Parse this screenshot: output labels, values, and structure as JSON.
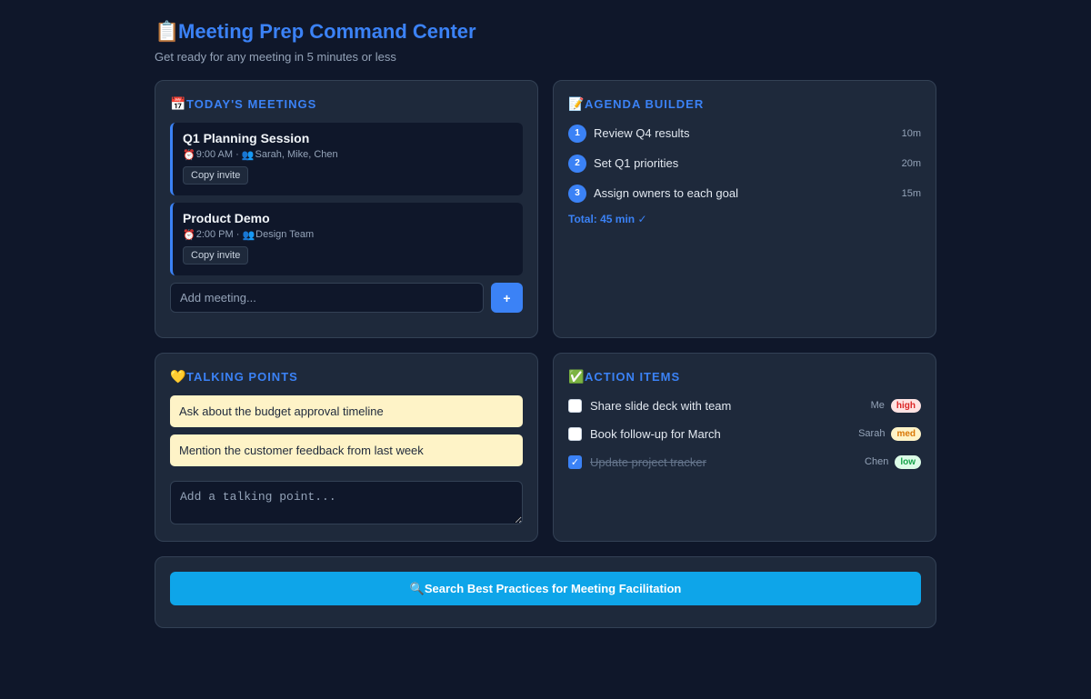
{
  "header": {
    "emoji": "📋",
    "title": "Meeting Prep Command Center",
    "subtitle": "Get ready for any meeting in 5 minutes or less"
  },
  "meetings_card": {
    "emoji": "📅",
    "heading": "TODAY'S MEETINGS",
    "meetings": [
      {
        "title": "Q1 Planning Session",
        "time_icon": "⏰",
        "time": "9:00 AM",
        "sep": " · ",
        "people_icon": "👥",
        "attendees": "Sarah, Mike, Chen",
        "copy_label": "Copy invite"
      },
      {
        "title": "Product Demo",
        "time_icon": "⏰",
        "time": "2:00 PM",
        "sep": " · ",
        "people_icon": "👥",
        "attendees": "Design Team",
        "copy_label": "Copy invite"
      }
    ],
    "add_placeholder": "Add meeting...",
    "add_button": "+"
  },
  "agenda_card": {
    "emoji": "📝",
    "heading": "AGENDA BUILDER",
    "items": [
      {
        "num": "1",
        "text": "Review Q4 results",
        "duration": "10m"
      },
      {
        "num": "2",
        "text": "Set Q1 priorities",
        "duration": "20m"
      },
      {
        "num": "3",
        "text": "Assign owners to each goal",
        "duration": "15m"
      }
    ],
    "total": "Total: 45 min ✓"
  },
  "talking_card": {
    "emoji": "💛",
    "heading": "TALKING POINTS",
    "points": [
      "Ask about the budget approval timeline",
      "Mention the customer feedback from last week"
    ],
    "input_placeholder": "Add a talking point..."
  },
  "actions_card": {
    "emoji": "✅",
    "heading": "ACTION ITEMS",
    "items": [
      {
        "text": "Share slide deck with team",
        "owner": "Me",
        "priority": "high",
        "checked": false
      },
      {
        "text": "Book follow-up for March",
        "owner": "Sarah",
        "priority": "med",
        "checked": false
      },
      {
        "text": "Update project tracker",
        "owner": "Chen",
        "priority": "low",
        "checked": true
      }
    ],
    "check_mark": "✓"
  },
  "search": {
    "emoji": "🔍",
    "label": "Search Best Practices for Meeting Facilitation"
  },
  "colors": {
    "background": "#0f172a",
    "card": "#1e293b",
    "accent": "#3b82f6",
    "sticky": "#fef3c7",
    "search_button": "#0ea5e9",
    "high_bg": "#fee2e2",
    "high_fg": "#dc2626",
    "med_bg": "#fef3c7",
    "med_fg": "#d97706",
    "low_bg": "#dcfce7",
    "low_fg": "#16a34a"
  }
}
